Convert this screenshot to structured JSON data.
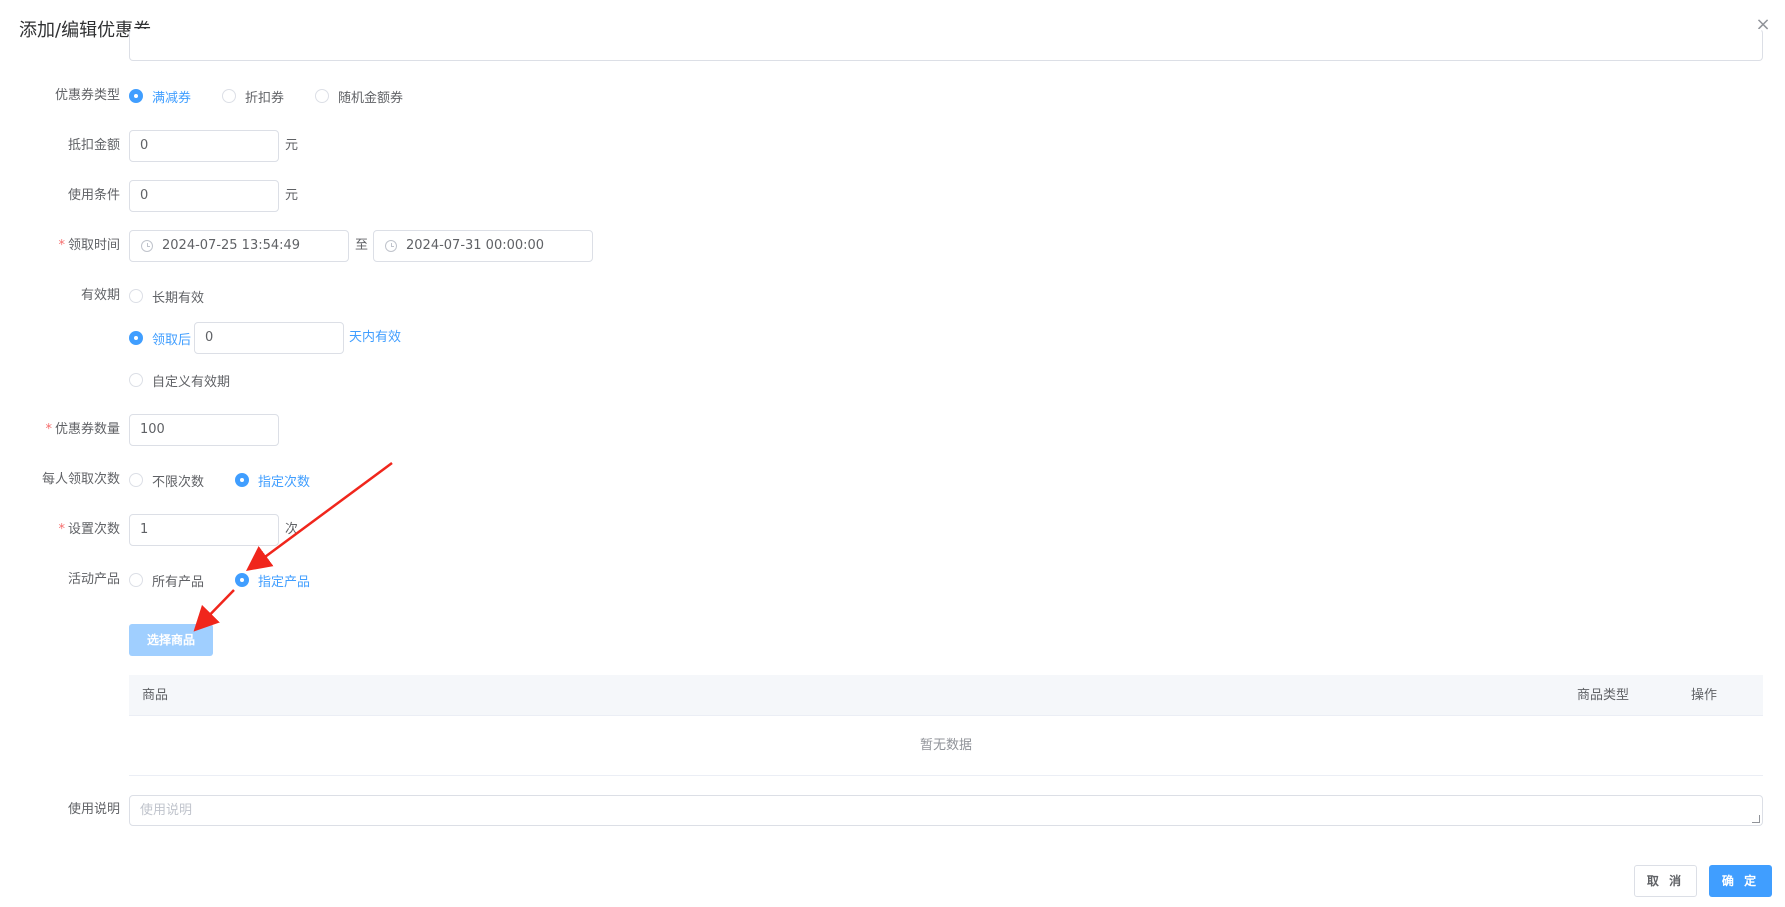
{
  "dialog": {
    "title": "添加/编辑优惠券",
    "close_symbol": "×"
  },
  "form": {
    "top_field": {
      "value": ""
    },
    "coupon_type": {
      "label": "优惠券类型",
      "options": [
        "满减券",
        "折扣券",
        "随机金额券"
      ],
      "selected": "满减券"
    },
    "deduct_amount": {
      "label": "抵扣金额",
      "value": "0",
      "unit": "元"
    },
    "use_condition": {
      "label": "使用条件",
      "value": "0",
      "unit": "元"
    },
    "receive_time": {
      "label": "领取时间",
      "required_mark": "*",
      "start": "2024-07-25 13:54:49",
      "separator": "至",
      "end": "2024-07-31 00:00:00"
    },
    "validity": {
      "label": "有效期",
      "option_long": "长期有效",
      "option_after": "领取后",
      "after_days_value": "0",
      "after_days_suffix": "天内有效",
      "option_custom": "自定义有效期",
      "selected": "领取后"
    },
    "coupon_count": {
      "label": "优惠券数量",
      "required_mark": "*",
      "value": "100"
    },
    "per_person": {
      "label": "每人领取次数",
      "options": [
        "不限次数",
        "指定次数"
      ],
      "selected": "指定次数"
    },
    "set_times": {
      "label": "设置次数",
      "required_mark": "*",
      "value": "1",
      "unit": "次"
    },
    "products": {
      "label": "活动产品",
      "options": [
        "所有产品",
        "指定产品"
      ],
      "selected": "指定产品",
      "select_button": "选择商品"
    },
    "table": {
      "columns": [
        "商品",
        "商品类型",
        "操作"
      ],
      "empty_text": "暂无数据"
    },
    "description": {
      "label": "使用说明",
      "placeholder": "使用说明"
    }
  },
  "footer": {
    "cancel": "取 消",
    "confirm": "确 定"
  },
  "colors": {
    "primary": "#409eff",
    "primary_light": "#a0cfff",
    "required": "#f56c6c",
    "annotation_arrow": "#f0261c"
  }
}
